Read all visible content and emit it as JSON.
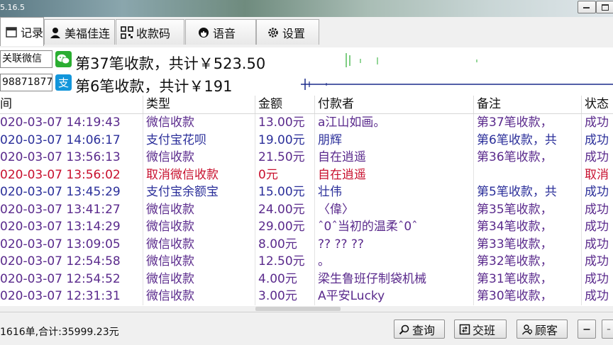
{
  "window": {
    "version_text": "5.16.5"
  },
  "tabs": [
    {
      "label": "记录",
      "icon": "calendar-icon"
    },
    {
      "label": "美福佳连",
      "icon": "user-icon"
    },
    {
      "label": "收款码",
      "icon": "qrcode-icon"
    },
    {
      "label": "语音",
      "icon": "speaker-icon"
    },
    {
      "label": "设置",
      "icon": "gear-icon"
    }
  ],
  "accounts": [
    {
      "label": "关联微信",
      "icon": "wechat-icon",
      "summary": "第37笔收款，共计￥523.50"
    },
    {
      "label": "98871877",
      "icon": "alipay-icon",
      "summary": "第6笔收款，共计￥191"
    }
  ],
  "table": {
    "headers": [
      "间",
      "类型",
      "金额",
      "付款者",
      "备注",
      "状态"
    ],
    "rows": [
      {
        "time": "020-03-07 14:19:43",
        "type": "微信收款",
        "amount": "13.00元",
        "payer": "a江山如画。",
        "note": "第37笔收款，",
        "status": "成功",
        "color": "purple"
      },
      {
        "time": "020-03-07 14:06:17",
        "type": "支付宝花呗",
        "amount": "19.00元",
        "payer": "朋辉",
        "note": "第6笔收款，共",
        "status": "成功",
        "color": "blue"
      },
      {
        "time": "020-03-07 13:56:13",
        "type": "微信收款",
        "amount": "21.50元",
        "payer": "自在逍遥",
        "note": "第36笔收款，",
        "status": "成功",
        "color": "purple"
      },
      {
        "time": "020-03-07 13:56:02",
        "type": "取消微信收款",
        "amount": "0元",
        "payer": "自在逍遥",
        "note": "",
        "status": "取消",
        "color": "red"
      },
      {
        "time": "020-03-07 13:45:29",
        "type": "支付宝余额宝",
        "amount": "15.00元",
        "payer": "壮伟",
        "note": "第5笔收款，共",
        "status": "成功",
        "color": "blue"
      },
      {
        "time": "020-03-07 13:41:27",
        "type": "微信收款",
        "amount": "24.00元",
        "payer": "〈偉〉",
        "note": "第35笔收款，",
        "status": "成功",
        "color": "purple"
      },
      {
        "time": "020-03-07 13:14:29",
        "type": "微信收款",
        "amount": "29.00元",
        "payer": "ˆ0ˆ当初的温柔ˆ0ˆ",
        "note": "第34笔收款，",
        "status": "成功",
        "color": "purple"
      },
      {
        "time": "020-03-07 13:09:05",
        "type": "微信收款",
        "amount": "8.00元",
        "payer": "?? ?? ??",
        "note": "第33笔收款，",
        "status": "成功",
        "color": "purple"
      },
      {
        "time": "020-03-07 12:54:58",
        "type": "微信收款",
        "amount": "12.50元",
        "payer": "。",
        "note": "第32笔收款，",
        "status": "成功",
        "color": "purple"
      },
      {
        "time": "020-03-07 12:54:52",
        "type": "微信收款",
        "amount": "4.00元",
        "payer": "梁生鲁班仔制袋机械",
        "note": "第31笔收款，",
        "status": "成功",
        "color": "purple"
      },
      {
        "time": "020-03-07 12:31:31",
        "type": "微信收款",
        "amount": "3.00元",
        "payer": "A平安Lucky",
        "note": "第30笔收款，",
        "status": "成功",
        "color": "purple"
      }
    ]
  },
  "status_bar": {
    "summary": "1616单,合计:35999.23元",
    "buttons": [
      {
        "label": "查询",
        "icon": "search-icon"
      },
      {
        "label": "交班",
        "icon": "handover-icon"
      },
      {
        "label": "顾客",
        "icon": "customer-icon"
      }
    ]
  },
  "colors": {
    "purple": "#5a2a8c",
    "blue": "#2b2f9a",
    "red": "#c8102e",
    "wechat": "#2aae31",
    "alipay": "#1296db"
  }
}
